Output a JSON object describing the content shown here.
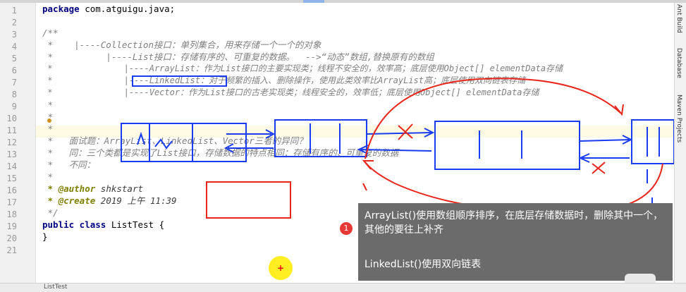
{
  "editor": {
    "line_numbers": [
      "1",
      "2",
      "3",
      "4",
      "5",
      "6",
      "7",
      "8",
      "9",
      "10",
      "11",
      "12",
      "13",
      "14",
      "15",
      "16",
      "17",
      "18",
      "19",
      "20",
      "21"
    ],
    "lines": {
      "l1_kw": "package",
      "l1_rest": " com.atguigu.java;",
      "l3": "/**",
      "l4": " *    |----Collection接口：单列集合，用来存储一个一个的对象",
      "l5": " *          |----List接口：存储有序的、可重复的数据。  -->“动态”数组,替换原有的数组",
      "l6": " *              |----ArrayList：作为List接口的主要实现类；线程不安全的，效率高；底层使用Object[] elementData存储",
      "l7": " *              |----LinkedList：对于频繁的插入、删除操作，使用此类效率比ArrayList高；底层使用双向链表存储",
      "l8": " *              |----Vector：作为List接口的古老实现类；线程安全的，效率低；底层使用Object[] elementData存储",
      "l9": " *",
      "l10": " *",
      "l11": " *",
      "l12": " *   面试题：ArrayList、LinkedList、Vector三者的异同？",
      "l13": " *   同：三个类都是实现了List接口，存储数据的特点相同：存储有序的、可重复的数据",
      "l14": " *   不同：",
      "l15": " *",
      "l16_tag": " * @author",
      "l16_val": " shkstart",
      "l17_tag": " * @create",
      "l17_val": " 2019 上午 11:39",
      "l18": " */",
      "l19_kw": "public class",
      "l19_rest": " ListTest {",
      "l20": "}"
    }
  },
  "sidebar": {
    "labels": [
      "Ant Build",
      "Database",
      "Maven Projects"
    ]
  },
  "status_bar": {
    "text": "ListTest"
  },
  "tooltip": {
    "badge": "1",
    "line1": "ArrayList()使用数组顺序排序，在底层存储数据时，删除其中一个，其他的要往上补齐",
    "line2": "LinkedList()使用双向链表"
  },
  "cursor": {
    "symbol": "+"
  },
  "colors": {
    "annotation_blue": "#1a3cf0",
    "annotation_red": "#e8261c",
    "tooltip_bg": "#6b6b6b",
    "highlight_line": "#fffae3"
  }
}
